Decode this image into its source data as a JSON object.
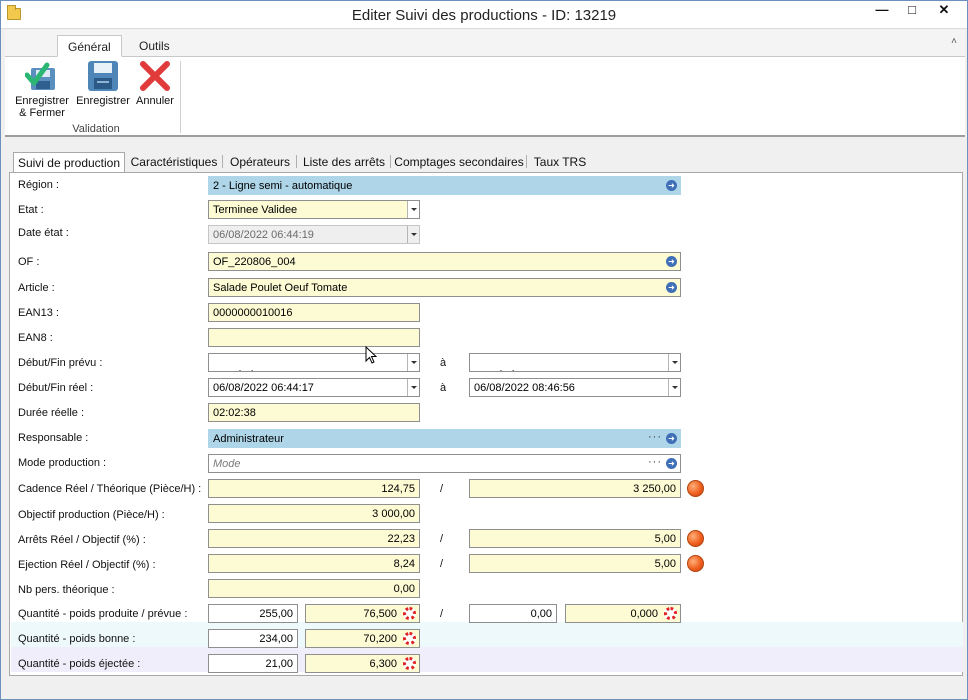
{
  "window": {
    "title": "Editer Suivi des productions - ID: 13219",
    "min_label": "—",
    "max_label": "□",
    "close_label": "✕"
  },
  "ribbon": {
    "tabs": [
      "Général",
      "Outils"
    ],
    "collapse_label": "˄",
    "buttons": [
      {
        "label_line1": "Enregistrer",
        "label_line2": "& Fermer",
        "icon": "save-close-icon"
      },
      {
        "label_line1": "Enregistrer",
        "icon": "floppy-disk-icon"
      },
      {
        "label_line1": "Annuler",
        "icon": "cancel-x-icon"
      }
    ],
    "group_label": "Validation"
  },
  "tabs": [
    "Suivi de production",
    "Caractéristiques",
    "Opérateurs",
    "Liste des arrêts",
    "Comptages secondaires",
    "Taux TRS"
  ],
  "form": {
    "region": {
      "label": "Région :",
      "value": "2 - Ligne semi - automatique"
    },
    "etat": {
      "label": "Etat :",
      "value": "Terminee Validee"
    },
    "date_etat": {
      "label": "Date état :",
      "value": "06/08/2022 06:44:19"
    },
    "of": {
      "label": "OF :",
      "value": "OF_220806_004"
    },
    "article": {
      "label": "Article :",
      "value": "Salade Poulet Oeuf Tomate"
    },
    "ean13": {
      "label": "EAN13 :",
      "value": "0000000010016"
    },
    "ean8": {
      "label": "EAN8 :",
      "value": ""
    },
    "debut_fin_prevu": {
      "label": "Début/Fin prévu :",
      "start": "  /   /          :   :",
      "sep": "à",
      "end": "  /   /          :   :"
    },
    "debut_fin_reel": {
      "label": "Début/Fin réel :",
      "start": "06/08/2022 06:44:17",
      "sep": "à",
      "end": "06/08/2022 08:46:56"
    },
    "duree_reelle": {
      "label": "Durée réelle :",
      "value": "02:02:38"
    },
    "responsable": {
      "label": "Responsable :",
      "value": "Administrateur",
      "dots": "···"
    },
    "mode_production": {
      "label": "Mode production :",
      "placeholder": "Mode",
      "dots": "···"
    },
    "cadence": {
      "label": "Cadence Réel / Théorique (Pièce/H) :",
      "real": "124,75",
      "sep": "/",
      "target": "3 250,00",
      "status_color": "#f06020"
    },
    "objectif_production": {
      "label": "Objectif production (Pièce/H) :",
      "value": "3 000,00"
    },
    "arrets": {
      "label": "Arrêts Réel / Objectif (%) :",
      "real": "22,23",
      "sep": "/",
      "target": "5,00",
      "status_color": "#f06020"
    },
    "ejection": {
      "label": "Ejection Réel / Objectif (%) :",
      "real": "8,24",
      "sep": "/",
      "target": "5,00",
      "status_color": "#f06020"
    },
    "nb_pers": {
      "label": "Nb pers. théorique :",
      "value": "0,00"
    },
    "qte_produite": {
      "label": "Quantité - poids produite / prévue :",
      "qty": "255,00",
      "weight": "76,500",
      "sep": "/",
      "qty2": "0,00",
      "weight2": "0,000"
    },
    "qte_bonne": {
      "label": "Quantité - poids bonne :",
      "qty": "234,00",
      "weight": "70,200"
    },
    "qte_ejectee": {
      "label": "Quantité - poids éjectée :",
      "qty": "21,00",
      "weight": "6,300"
    }
  }
}
